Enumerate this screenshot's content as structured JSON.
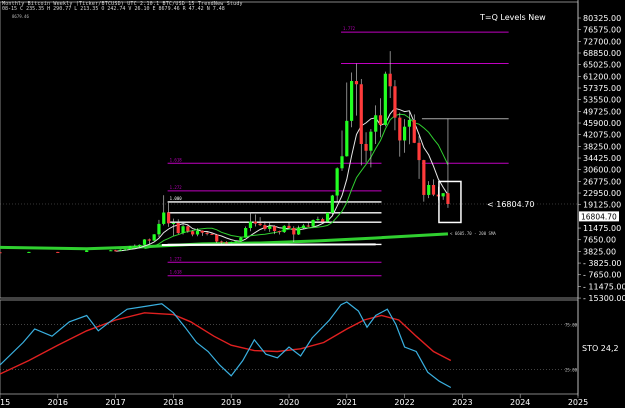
{
  "header": {
    "line1": "Monthly Bitcoin Weekly (Ticker/BTCUSD) UTC 2.10.1 BTC/USD 15 TrendNew Study",
    "line2": "08-15  C 235.35  H 290.77  L 213.35  O 242.74  V 26.10  E 8679.46  R 47.42  N 7.48",
    "line3": "8679.46"
  },
  "chart_data": {
    "type": "candlestick",
    "title": "T=Q Levels New",
    "current_price_label": "< 16804.70",
    "current_price_tag": "16804.70",
    "price_axis_ticks": [
      "80325.00",
      "76575.00",
      "72700.00",
      "68850.00",
      "65025.00",
      "61200.00",
      "57375.00",
      "53550.00",
      "49725.00",
      "45900.00",
      "42075.00",
      "38250.00",
      "34425.00",
      "30600.00",
      "26775.00",
      "22950.00",
      "19125.00",
      "16804.70",
      "11475.00",
      "7650.00",
      "3825.00",
      "- 3825.00",
      "- 7650.00",
      "- 11475.00",
      "- 15300.00"
    ],
    "x_ticks": [
      "2015",
      "2016",
      "2017",
      "2018",
      "2019",
      "2020",
      "2021",
      "2022",
      "2023",
      "2024",
      "2025"
    ],
    "x_range": [
      2015.0,
      2025.0
    ],
    "candles": [
      {
        "t": 2015.0,
        "o": 320,
        "c": 230,
        "h": 330,
        "l": 180
      },
      {
        "t": 2015.5,
        "o": 230,
        "c": 430,
        "h": 500,
        "l": 200
      },
      {
        "t": 2016.0,
        "o": 430,
        "c": 420,
        "h": 470,
        "l": 370
      },
      {
        "t": 2016.5,
        "o": 420,
        "c": 960,
        "h": 1000,
        "l": 400
      },
      {
        "t": 2016.917,
        "o": 960,
        "c": 1000,
        "h": 1150,
        "l": 850
      },
      {
        "t": 2017.0,
        "o": 1000,
        "c": 960,
        "h": 1150,
        "l": 750
      },
      {
        "t": 2017.083,
        "o": 960,
        "c": 1190,
        "h": 1300,
        "l": 920
      },
      {
        "t": 2017.167,
        "o": 1190,
        "c": 1350,
        "h": 1450,
        "l": 900
      },
      {
        "t": 2017.25,
        "o": 1350,
        "c": 2300,
        "h": 2500,
        "l": 1200
      },
      {
        "t": 2017.333,
        "o": 2300,
        "c": 2450,
        "h": 3000,
        "l": 2100
      },
      {
        "t": 2017.417,
        "o": 2450,
        "c": 2850,
        "h": 3000,
        "l": 1800
      },
      {
        "t": 2017.5,
        "o": 2850,
        "c": 4700,
        "h": 4800,
        "l": 2700
      },
      {
        "t": 2017.583,
        "o": 4700,
        "c": 4300,
        "h": 5000,
        "l": 2950
      },
      {
        "t": 2017.667,
        "o": 4300,
        "c": 6450,
        "h": 6500,
        "l": 4200
      },
      {
        "t": 2017.75,
        "o": 6450,
        "c": 10000,
        "h": 11400,
        "l": 5500
      },
      {
        "t": 2017.833,
        "o": 10000,
        "c": 13900,
        "h": 19800,
        "l": 9500
      },
      {
        "t": 2017.917,
        "o": 13900,
        "c": 10200,
        "h": 17200,
        "l": 9000
      },
      {
        "t": 2018.0,
        "o": 10200,
        "c": 10300,
        "h": 11800,
        "l": 6000
      },
      {
        "t": 2018.083,
        "o": 10300,
        "c": 6900,
        "h": 11600,
        "l": 6500
      },
      {
        "t": 2018.167,
        "o": 6900,
        "c": 9200,
        "h": 9900,
        "l": 6400
      },
      {
        "t": 2018.25,
        "o": 9200,
        "c": 7500,
        "h": 9900,
        "l": 7000
      },
      {
        "t": 2018.333,
        "o": 7500,
        "c": 6400,
        "h": 7800,
        "l": 5800
      },
      {
        "t": 2018.417,
        "o": 6400,
        "c": 7700,
        "h": 8500,
        "l": 5800
      },
      {
        "t": 2018.5,
        "o": 7700,
        "c": 7000,
        "h": 7800,
        "l": 5900
      },
      {
        "t": 2018.583,
        "o": 7000,
        "c": 6600,
        "h": 7400,
        "l": 6100
      },
      {
        "t": 2018.667,
        "o": 6600,
        "c": 6300,
        "h": 7000,
        "l": 6200
      },
      {
        "t": 2018.75,
        "o": 6300,
        "c": 4000,
        "h": 6600,
        "l": 3500
      },
      {
        "t": 2018.833,
        "o": 4000,
        "c": 3700,
        "h": 4300,
        "l": 3200
      },
      {
        "t": 2018.917,
        "o": 3700,
        "c": 3450,
        "h": 4100,
        "l": 3300
      },
      {
        "t": 2019.0,
        "o": 3450,
        "c": 3800,
        "h": 3950,
        "l": 3400
      },
      {
        "t": 2019.083,
        "o": 3800,
        "c": 4100,
        "h": 4200,
        "l": 3700
      },
      {
        "t": 2019.167,
        "o": 4100,
        "c": 5300,
        "h": 5600,
        "l": 4050
      },
      {
        "t": 2019.25,
        "o": 5300,
        "c": 8600,
        "h": 9100,
        "l": 5300
      },
      {
        "t": 2019.333,
        "o": 8600,
        "c": 10800,
        "h": 13900,
        "l": 7500
      },
      {
        "t": 2019.417,
        "o": 10800,
        "c": 10100,
        "h": 13200,
        "l": 9100
      },
      {
        "t": 2019.5,
        "o": 10100,
        "c": 9600,
        "h": 12300,
        "l": 9300
      },
      {
        "t": 2019.583,
        "o": 9600,
        "c": 8300,
        "h": 10900,
        "l": 7700
      },
      {
        "t": 2019.667,
        "o": 8300,
        "c": 9200,
        "h": 10400,
        "l": 7300
      },
      {
        "t": 2019.75,
        "o": 9200,
        "c": 7550,
        "h": 9500,
        "l": 6500
      },
      {
        "t": 2019.833,
        "o": 7550,
        "c": 7200,
        "h": 7700,
        "l": 6400
      },
      {
        "t": 2019.917,
        "o": 7200,
        "c": 9350,
        "h": 9600,
        "l": 6900
      },
      {
        "t": 2020.0,
        "o": 9350,
        "c": 8600,
        "h": 10500,
        "l": 8300
      },
      {
        "t": 2020.083,
        "o": 8600,
        "c": 6400,
        "h": 9200,
        "l": 3800
      },
      {
        "t": 2020.167,
        "o": 6400,
        "c": 8600,
        "h": 9400,
        "l": 6200
      },
      {
        "t": 2020.25,
        "o": 8600,
        "c": 9450,
        "h": 10000,
        "l": 8100
      },
      {
        "t": 2020.333,
        "o": 9450,
        "c": 9150,
        "h": 10400,
        "l": 8900
      },
      {
        "t": 2020.417,
        "o": 9150,
        "c": 11350,
        "h": 11500,
        "l": 8900
      },
      {
        "t": 2020.5,
        "o": 11350,
        "c": 11650,
        "h": 12500,
        "l": 11100
      },
      {
        "t": 2020.583,
        "o": 11650,
        "c": 10800,
        "h": 12100,
        "l": 10000
      },
      {
        "t": 2020.667,
        "o": 10800,
        "c": 13800,
        "h": 14000,
        "l": 10400
      },
      {
        "t": 2020.75,
        "o": 13800,
        "c": 19700,
        "h": 19900,
        "l": 13200
      },
      {
        "t": 2020.833,
        "o": 19700,
        "c": 29000,
        "h": 29300,
        "l": 17600
      },
      {
        "t": 2020.917,
        "o": 29000,
        "c": 33100,
        "h": 41900,
        "l": 28100
      },
      {
        "t": 2021.0,
        "o": 33100,
        "c": 45200,
        "h": 58300,
        "l": 33000
      },
      {
        "t": 2021.083,
        "o": 45200,
        "c": 58800,
        "h": 61700,
        "l": 43000
      },
      {
        "t": 2021.167,
        "o": 58800,
        "c": 57700,
        "h": 64800,
        "l": 47000
      },
      {
        "t": 2021.25,
        "o": 57700,
        "c": 37300,
        "h": 59500,
        "l": 30000
      },
      {
        "t": 2021.333,
        "o": 37300,
        "c": 35000,
        "h": 41300,
        "l": 31000
      },
      {
        "t": 2021.417,
        "o": 35000,
        "c": 41500,
        "h": 42400,
        "l": 29300
      },
      {
        "t": 2021.5,
        "o": 41500,
        "c": 47100,
        "h": 50500,
        "l": 37300
      },
      {
        "t": 2021.583,
        "o": 47100,
        "c": 43800,
        "h": 52900,
        "l": 39600
      },
      {
        "t": 2021.667,
        "o": 43800,
        "c": 61300,
        "h": 62000,
        "l": 43300
      },
      {
        "t": 2021.75,
        "o": 61300,
        "c": 57000,
        "h": 69000,
        "l": 53000
      },
      {
        "t": 2021.833,
        "o": 57000,
        "c": 46300,
        "h": 59100,
        "l": 42000
      },
      {
        "t": 2021.917,
        "o": 46300,
        "c": 38500,
        "h": 48000,
        "l": 33000
      },
      {
        "t": 2022.0,
        "o": 38500,
        "c": 43200,
        "h": 45800,
        "l": 34300
      },
      {
        "t": 2022.083,
        "o": 43200,
        "c": 45500,
        "h": 48200,
        "l": 37200
      },
      {
        "t": 2022.167,
        "o": 45500,
        "c": 37700,
        "h": 47400,
        "l": 37600
      },
      {
        "t": 2022.25,
        "o": 37700,
        "c": 31800,
        "h": 40000,
        "l": 25400
      },
      {
        "t": 2022.333,
        "o": 31800,
        "c": 19900,
        "h": 31900,
        "l": 17600
      },
      {
        "t": 2022.417,
        "o": 19900,
        "c": 23300,
        "h": 24600,
        "l": 18800
      },
      {
        "t": 2022.5,
        "o": 23300,
        "c": 20000,
        "h": 25200,
        "l": 19500
      },
      {
        "t": 2022.583,
        "o": 20000,
        "c": 19400,
        "h": 22700,
        "l": 18100
      },
      {
        "t": 2022.667,
        "o": 19400,
        "c": 20500,
        "h": 20500,
        "l": 18200
      },
      {
        "t": 2022.75,
        "o": 20500,
        "c": 16804.7,
        "h": 46000,
        "l": 15500
      }
    ],
    "levels": [
      {
        "label": "1.772",
        "value": 75500,
        "color": "#c000c0",
        "t0": 2020.9,
        "t1": 2023.8
      },
      {
        "label": "",
        "value": 64800,
        "color": "#c000c0",
        "t0": 2020.9,
        "t1": 2023.8
      },
      {
        "label": "",
        "value": 45900,
        "color": "#aaaaaa",
        "t0": 2022.3,
        "t1": 2023.8
      },
      {
        "label": "1.618",
        "value": 30700,
        "color": "#c000c0",
        "t0": 2017.9,
        "t1": 2021.6
      },
      {
        "label": "",
        "value": 30700,
        "color": "#c000c0",
        "t0": 2022.3,
        "t1": 2023.8
      },
      {
        "label": "1.272",
        "value": 21300,
        "color": "#c000c0",
        "t0": 2017.9,
        "t1": 2021.6
      },
      {
        "label": "1.000",
        "value": 17500,
        "color": "#ffffff",
        "t0": 2017.9,
        "t1": 2021.6
      },
      {
        "label": "",
        "value": 13800,
        "color": "#ffffff",
        "t0": 2017.9,
        "t1": 2021.6
      },
      {
        "label": "",
        "value": 10600,
        "color": "#ffffff",
        "t0": 2017.9,
        "t1": 2021.6
      },
      {
        "label": "",
        "value": 3000,
        "color": "#ffffff",
        "t0": 2017.9,
        "t1": 2021.6
      },
      {
        "label": "1.272",
        "value": -3100,
        "color": "#c000c0",
        "t0": 2017.9,
        "t1": 2021.6
      },
      {
        "label": "1.618",
        "value": -7700,
        "color": "#c000c0",
        "t0": 2017.9,
        "t1": 2021.6
      }
    ],
    "sma_label": "< 6605.70 - 200 SMA",
    "stochastic": {
      "label": "STO  24,2",
      "levels": [
        75,
        25
      ],
      "k": [
        [
          2015.0,
          30
        ],
        [
          2015.4,
          55
        ],
        [
          2015.6,
          70
        ],
        [
          2015.9,
          62
        ],
        [
          2016.2,
          78
        ],
        [
          2016.5,
          85
        ],
        [
          2016.7,
          68
        ],
        [
          2016.9,
          78
        ],
        [
          2017.2,
          92
        ],
        [
          2017.5,
          95
        ],
        [
          2017.8,
          98
        ],
        [
          2018.0,
          88
        ],
        [
          2018.2,
          72
        ],
        [
          2018.4,
          55
        ],
        [
          2018.6,
          45
        ],
        [
          2018.8,
          30
        ],
        [
          2019.0,
          18
        ],
        [
          2019.2,
          35
        ],
        [
          2019.4,
          58
        ],
        [
          2019.6,
          42
        ],
        [
          2019.8,
          38
        ],
        [
          2020.0,
          50
        ],
        [
          2020.2,
          40
        ],
        [
          2020.4,
          60
        ],
        [
          2020.7,
          80
        ],
        [
          2020.9,
          97
        ],
        [
          2021.0,
          100
        ],
        [
          2021.2,
          90
        ],
        [
          2021.35,
          72
        ],
        [
          2021.5,
          85
        ],
        [
          2021.7,
          92
        ],
        [
          2021.85,
          75
        ],
        [
          2022.0,
          50
        ],
        [
          2022.2,
          45
        ],
        [
          2022.4,
          22
        ],
        [
          2022.6,
          12
        ],
        [
          2022.8,
          5
        ]
      ],
      "d": [
        [
          2015.0,
          20
        ],
        [
          2015.5,
          35
        ],
        [
          2016.0,
          52
        ],
        [
          2016.5,
          68
        ],
        [
          2017.0,
          80
        ],
        [
          2017.5,
          88
        ],
        [
          2018.0,
          86
        ],
        [
          2018.3,
          78
        ],
        [
          2018.7,
          62
        ],
        [
          2019.0,
          52
        ],
        [
          2019.4,
          46
        ],
        [
          2019.8,
          45
        ],
        [
          2020.2,
          48
        ],
        [
          2020.6,
          55
        ],
        [
          2021.0,
          70
        ],
        [
          2021.3,
          80
        ],
        [
          2021.6,
          85
        ],
        [
          2021.9,
          80
        ],
        [
          2022.2,
          62
        ],
        [
          2022.5,
          45
        ],
        [
          2022.8,
          35
        ]
      ]
    }
  }
}
